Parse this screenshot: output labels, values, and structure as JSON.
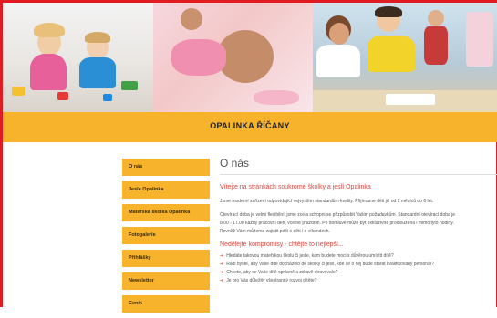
{
  "header": {
    "title": "OPALINKA ŘÍČANY"
  },
  "sidebar": {
    "items": [
      {
        "label": "O nás"
      },
      {
        "label": "Jesle Opalinka"
      },
      {
        "label": "Mateřská školka Opalinka"
      },
      {
        "label": "Fotogalerie"
      },
      {
        "label": "Přihlášky"
      },
      {
        "label": "Newsletter"
      },
      {
        "label": "Ceník"
      }
    ]
  },
  "main": {
    "page_title": "O nás",
    "welcome_heading": "Vítejte na stránkách soukromé školky a jeslí Opalinka",
    "para1": "Jsme moderní zařízení odpovídající nejvyšším standardům kvality.  Přijímáme děti již od 2 měsíců do 6 let.",
    "para2_line1": "Otevírací doba je velmi flexibilní, jsme zcela schopni se přizpůsobit Vašim požadavkům. Standardní otevírací doba je",
    "para2_line2": "8.00 - 17.00 každý pracovní den, včetně prázdnin. Po domluvě může být exkluzivně prodloužena i mimo tyto hodiny.",
    "para2_line3": "Rovněž Vám můžeme zajistit péči o děti i o víkendech.",
    "compromise_heading": "Nedělejte kompromisy - chtějte to nejlepší...",
    "bullets": [
      "Hledáte takovou mateřskou školu či jesle, kam budete moci s důvěrou umístit dítě?",
      "Rádi byste, aby Vaše dítě docházelo do školky či jeslí, kde se o něj bude starat kvalifikovaný personál?",
      "Chcete, aby se Vaše dítě správně a zdravě stravovalo?",
      "Je pro Vás důležitý všestranný rozvoj dítěte?"
    ]
  },
  "colors": {
    "accent": "#f7b32b",
    "frame": "#e11b22",
    "heading_red": "#e0463d"
  }
}
